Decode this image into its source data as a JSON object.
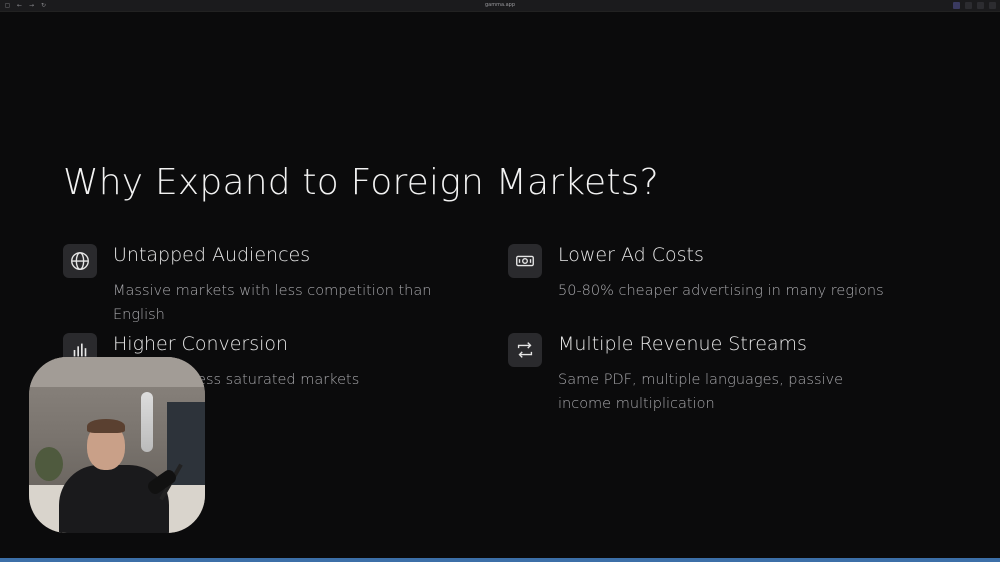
{
  "browser": {
    "url": "gamma.app",
    "accent_color": "#3c6fa8"
  },
  "slide": {
    "title": "Why Expand to Foreign Markets?",
    "features": [
      {
        "icon": "globe-icon",
        "title": "Untapped Audiences",
        "description": "Massive markets with less competition than English"
      },
      {
        "icon": "banknote-icon",
        "title": "Lower Ad Costs",
        "description": "50-80% cheaper advertising in many regions"
      },
      {
        "icon": "bar-chart-icon",
        "title": "Higher Conversion",
        "description": "less saturated markets"
      },
      {
        "icon": "repeat-icon",
        "title": "Multiple Revenue Streams",
        "description": "Same PDF, multiple languages, passive income multiplication"
      }
    ]
  }
}
